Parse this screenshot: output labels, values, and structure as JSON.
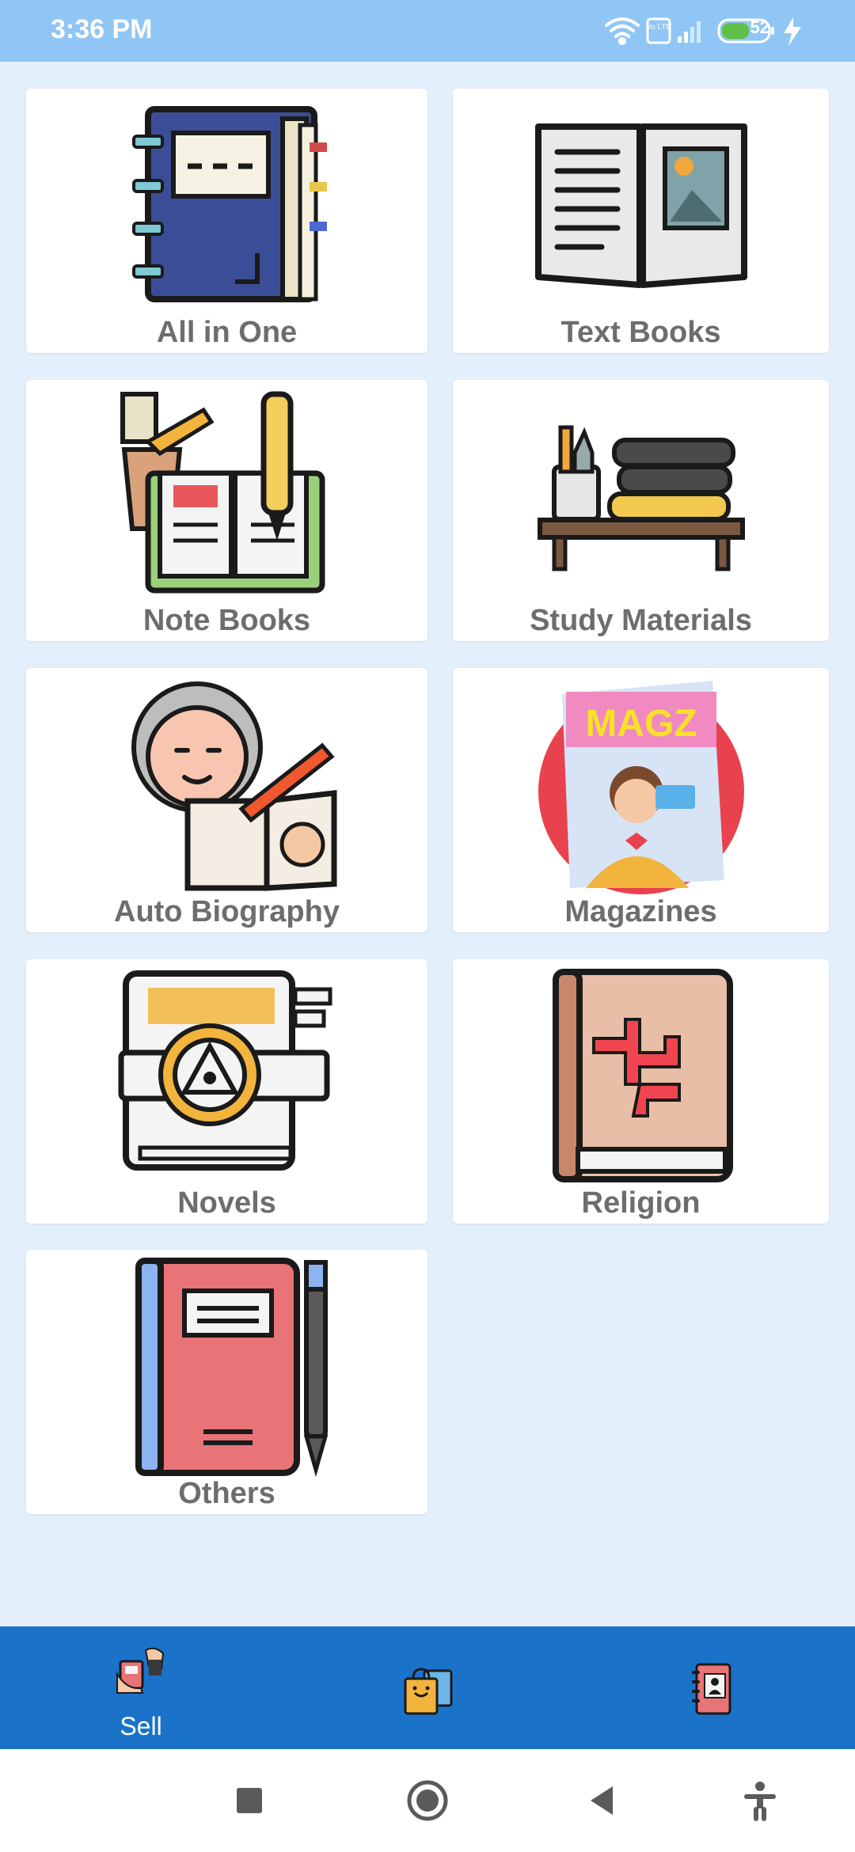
{
  "status_bar": {
    "time": "3:36 PM",
    "battery": "52",
    "network_badge": "Vo LTE"
  },
  "categories": [
    {
      "label": "All in One",
      "icon": "notebook-binder-icon"
    },
    {
      "label": "Text Books",
      "icon": "open-book-icon"
    },
    {
      "label": "Note Books",
      "icon": "notebook-stationery-icon"
    },
    {
      "label": "Study Materials",
      "icon": "bookshelf-icon"
    },
    {
      "label": "Auto Biography",
      "icon": "autobiography-icon"
    },
    {
      "label": "Magazines",
      "icon": "magazine-icon"
    },
    {
      "label": "Novels",
      "icon": "novel-book-icon"
    },
    {
      "label": "Religion",
      "icon": "religion-book-icon"
    },
    {
      "label": "Others",
      "icon": "other-book-icon"
    }
  ],
  "bottom_nav": [
    {
      "label": "Sell",
      "icon": "sell-hands-icon"
    },
    {
      "label": "",
      "icon": "shopping-bags-icon"
    },
    {
      "label": "",
      "icon": "contact-book-icon"
    }
  ],
  "system_nav": [
    "recents-button",
    "home-button",
    "back-button",
    "accessibility-button"
  ]
}
